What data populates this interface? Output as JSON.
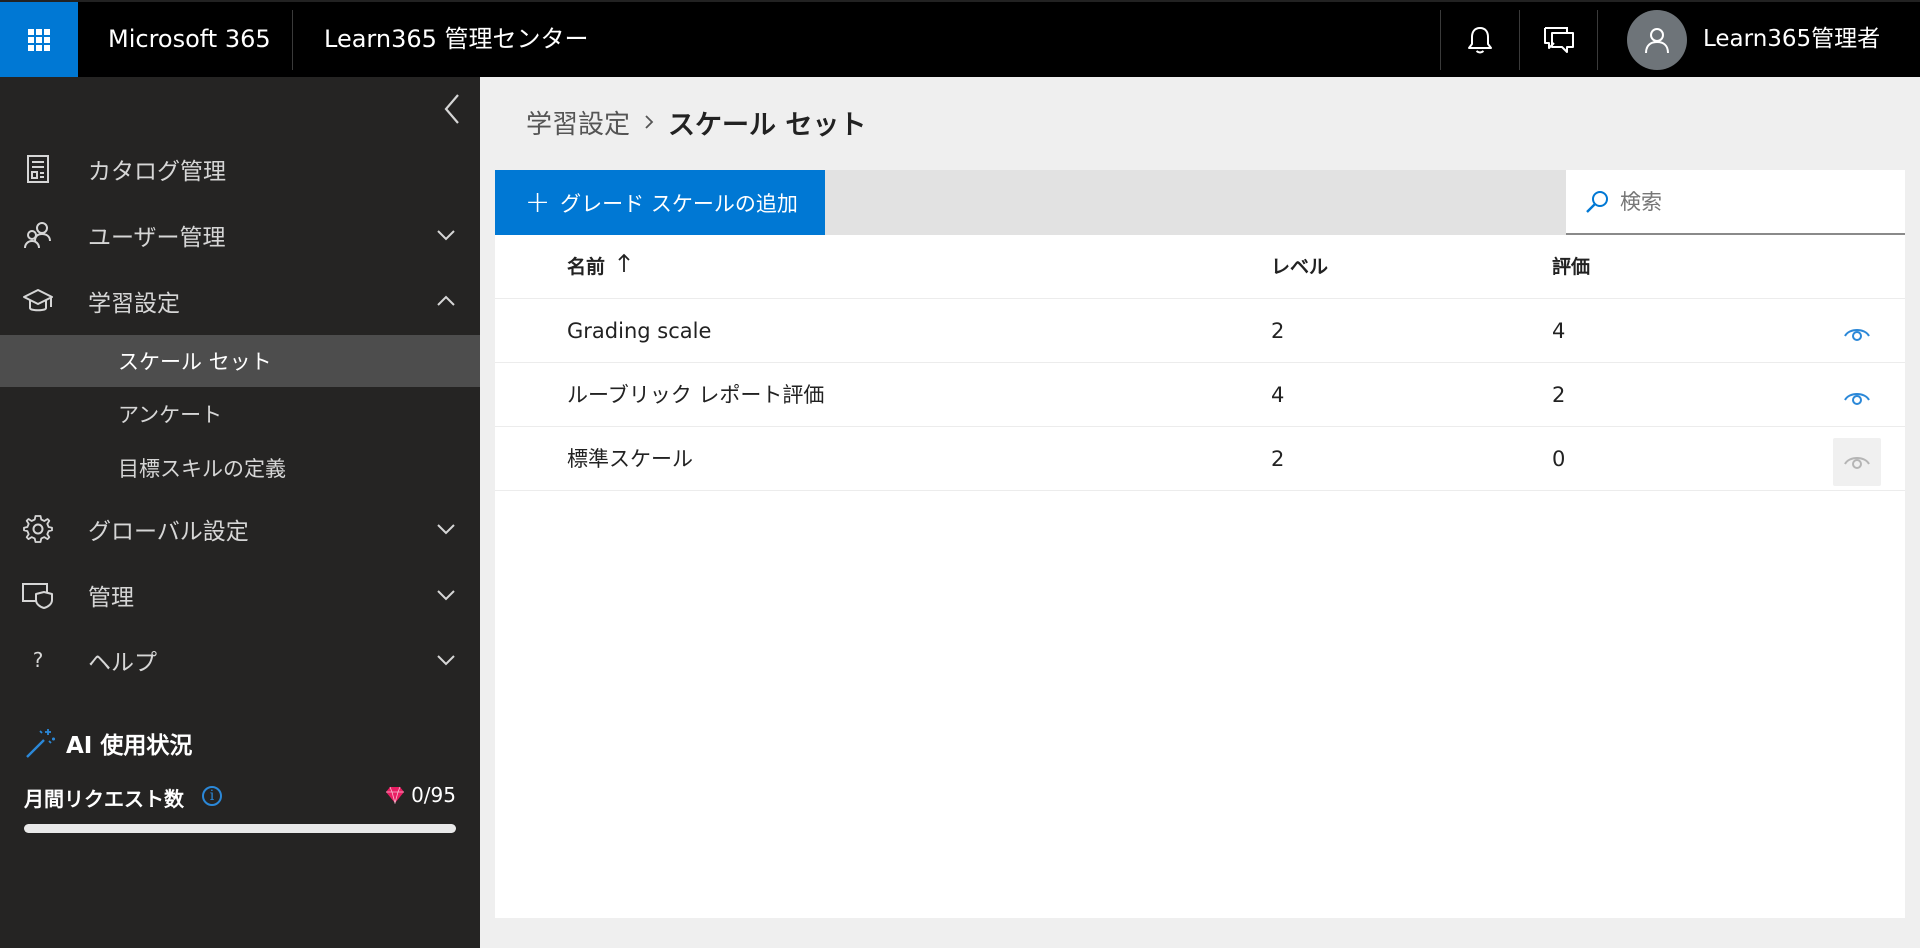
{
  "topbar": {
    "brand": "Microsoft 365",
    "app_title": "Learn365 管理センター",
    "user_name": "Learn365管理者",
    "icons": [
      "waffle-icon",
      "bell-icon",
      "feedback-icon",
      "person-icon"
    ]
  },
  "sidebar": {
    "items": [
      {
        "label": "カタログ管理",
        "icon": "catalog-icon",
        "expanded": null
      },
      {
        "label": "ユーザー管理",
        "icon": "users-icon",
        "expanded": false
      },
      {
        "label": "学習設定",
        "icon": "mortarboard-icon",
        "expanded": true
      },
      {
        "label": "グローバル設定",
        "icon": "gear-icon",
        "expanded": false
      },
      {
        "label": "管理",
        "icon": "shield-icon",
        "expanded": false
      },
      {
        "label": "ヘルプ",
        "icon": "help-icon",
        "expanded": false
      }
    ],
    "subitems": [
      {
        "label": "スケール セット",
        "active": true
      },
      {
        "label": "アンケート",
        "active": false
      },
      {
        "label": "目標スキルの定義",
        "active": false
      }
    ],
    "ai": {
      "title": "AI 使用状況",
      "requests_label": "月間リクエスト数",
      "requests_count": "0/95",
      "usage_fraction": 0
    }
  },
  "breadcrumb": {
    "parent": "学習設定",
    "current": "スケール セット"
  },
  "toolbar": {
    "add_label": "グレード スケールの追加",
    "search_placeholder": "検索"
  },
  "table": {
    "columns": {
      "name": "名前",
      "level": "レベル",
      "rating": "評価"
    },
    "sort": "name-ascending",
    "rows": [
      {
        "name": "Grading scale",
        "level": "2",
        "rating": "4",
        "view_enabled": true
      },
      {
        "name": "ルーブリック レポート評価",
        "level": "4",
        "rating": "2",
        "view_enabled": true
      },
      {
        "name": "標準スケール",
        "level": "2",
        "rating": "0",
        "view_enabled": false
      }
    ]
  },
  "colors": {
    "accent": "#0078d4",
    "topbar_bg": "#000000",
    "sidebar_bg": "#252423",
    "active_item_bg": "#4d4d4d",
    "eye_icon": "#2b88d8",
    "gem": "#e91e63"
  }
}
